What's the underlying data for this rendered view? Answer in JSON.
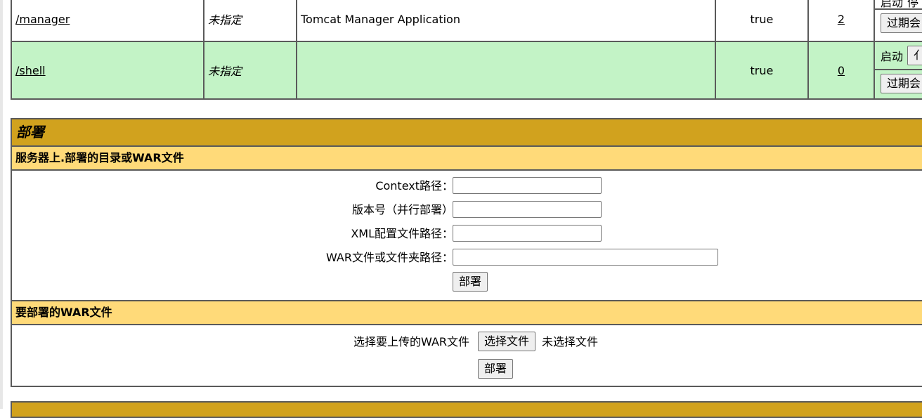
{
  "apps_table": {
    "rows": [
      {
        "path": "/manager",
        "version": "未指定",
        "display_name": "Tomcat Manager Application",
        "running": "true",
        "sessions": "2",
        "commands_top": [
          "启动",
          "停"
        ],
        "commands_bottom": "过期会"
      },
      {
        "path": "/shell",
        "version": "未指定",
        "display_name": "",
        "running": "true",
        "sessions": "0",
        "commands_top": [
          "启动",
          "亻"
        ],
        "commands_bottom": "过期会"
      }
    ]
  },
  "deploy": {
    "title": "部署",
    "server_section": {
      "title": "服务器上.部署的目录或WAR文件",
      "context_label": "Context路径：",
      "context_value": "",
      "version_label": "版本号（并行部署）",
      "version_value": "",
      "xml_label": "XML配置文件路径：",
      "xml_value": "",
      "war_label": "WAR文件或文件夹路径：",
      "war_value": "",
      "deploy_button": "部署"
    },
    "upload_section": {
      "title": "要部署的WAR文件",
      "choose_label": "选择要上传的WAR文件",
      "choose_button": "选择文件",
      "no_file_text": "未选择文件",
      "deploy_button": "部署"
    }
  },
  "colors": {
    "header_gold": "#d1a21e",
    "subheader_yellow": "#ffda79",
    "running_row_green": "#c3f3c6"
  }
}
